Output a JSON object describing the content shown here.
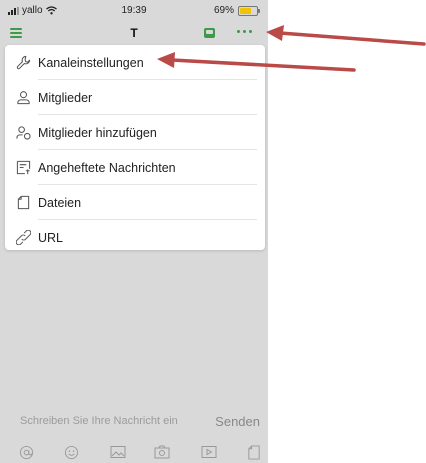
{
  "status_bar": {
    "carrier": "yallo",
    "time": "19:39",
    "battery": "69%"
  },
  "nav": {
    "title": "T"
  },
  "menu": {
    "items": [
      {
        "label": "Kanaleinstellungen",
        "icon": "wrench-icon"
      },
      {
        "label": "Mitglieder",
        "icon": "user-icon"
      },
      {
        "label": "Mitglieder hinzufügen",
        "icon": "add-user-icon"
      },
      {
        "label": "Angeheftete Nachrichten",
        "icon": "pinned-message-icon"
      },
      {
        "label": "Dateien",
        "icon": "file-icon"
      },
      {
        "label": "URL",
        "icon": "link-icon"
      }
    ]
  },
  "composer": {
    "placeholder": "Schreiben Sie Ihre Nachricht ein",
    "send_label": "Senden"
  },
  "toolbar": {
    "icons": [
      "at-icon",
      "emoji-icon",
      "image-icon",
      "camera-icon",
      "video-icon",
      "file-icon"
    ]
  },
  "colors": {
    "accent": "#3c9a4a",
    "annotation_arrow": "#b94a48",
    "battery": "#f0c400"
  }
}
